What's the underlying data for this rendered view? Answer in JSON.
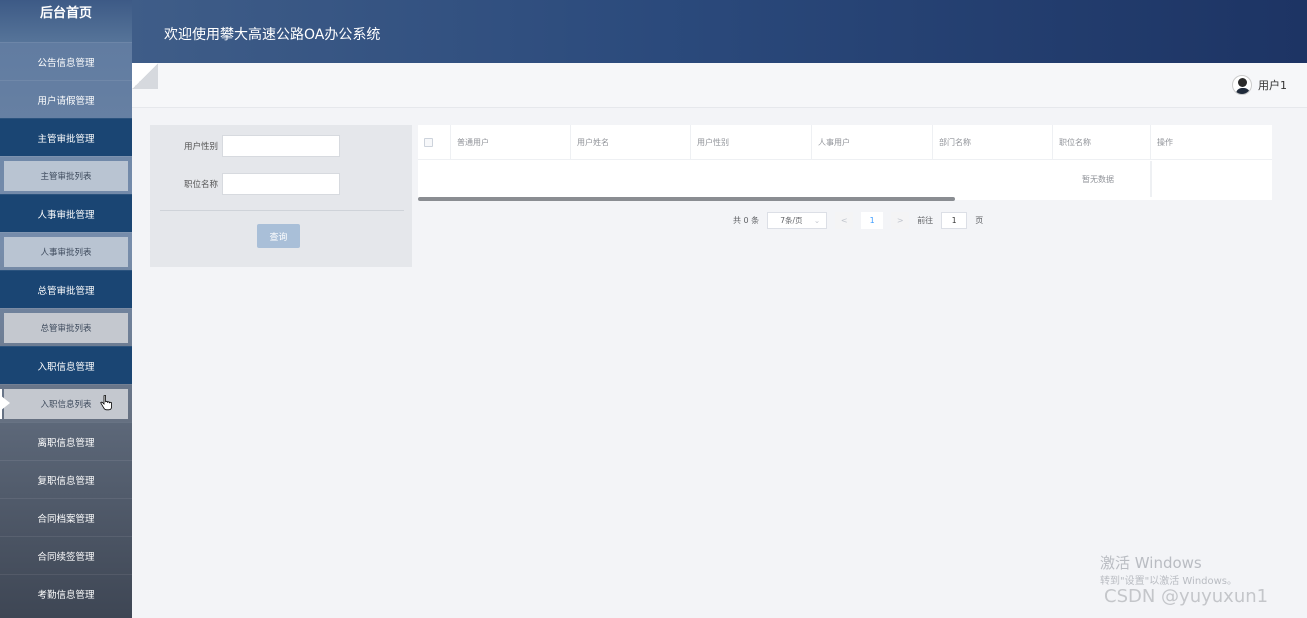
{
  "sidebar": {
    "logo": "后台首页",
    "items": [
      {
        "label": "公告信息管理"
      },
      {
        "label": "用户请假管理"
      },
      {
        "label": "主管审批管理"
      },
      {
        "label": "主管审批列表"
      },
      {
        "label": "人事审批管理"
      },
      {
        "label": "人事审批列表"
      },
      {
        "label": "总管审批管理"
      },
      {
        "label": "总管审批列表"
      },
      {
        "label": "入职信息管理"
      },
      {
        "label": "入职信息列表"
      },
      {
        "label": "离职信息管理"
      },
      {
        "label": "复职信息管理"
      },
      {
        "label": "合同档案管理"
      },
      {
        "label": "合同续签管理"
      },
      {
        "label": "考勤信息管理"
      }
    ]
  },
  "header": {
    "title": "欢迎使用攀大高速公路OA办公系统"
  },
  "user": {
    "name": "用户1"
  },
  "filter": {
    "gender_label": "用户性别",
    "gender_value": "",
    "position_label": "职位名称",
    "position_value": "",
    "query_button": "查询"
  },
  "table": {
    "columns": [
      "普通用户",
      "用户姓名",
      "用户性别",
      "人事用户",
      "部门名称",
      "职位名称",
      "操作"
    ],
    "empty_text": "暂无数据"
  },
  "pagination": {
    "total": "共 0 条",
    "page_size": "7条/页",
    "prev": "<",
    "current": "1",
    "next": ">",
    "goto_label": "前往",
    "goto_value": "1",
    "page_suffix": "页"
  },
  "watermark": {
    "activate": "激活 Windows",
    "activate_hint": "转到\"设置\"以激活 Windows。",
    "csdn": "CSDN @yuyuxun1"
  }
}
